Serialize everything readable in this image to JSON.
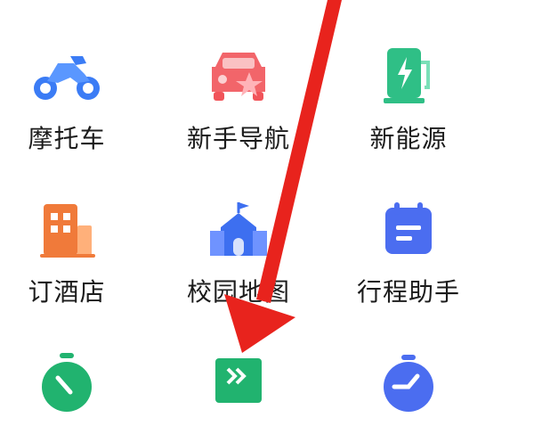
{
  "grid": {
    "items": [
      {
        "label": "摩托车",
        "icon": "motorcycle-icon"
      },
      {
        "label": "新手导航",
        "icon": "novice-car-icon"
      },
      {
        "label": "新能源",
        "icon": "ev-charging-icon"
      },
      {
        "label": "订酒店",
        "icon": "hotel-icon"
      },
      {
        "label": "校园地图",
        "icon": "campus-icon"
      },
      {
        "label": "行程助手",
        "icon": "calendar-icon"
      },
      {
        "label": "",
        "icon": "stopwatch-icon"
      },
      {
        "label": "",
        "icon": "forward-flag-icon"
      },
      {
        "label": "",
        "icon": "speed-timer-icon"
      }
    ]
  },
  "colors": {
    "arrow": "#e8231d",
    "motorcycle": "#3b7cf5",
    "car": "#f1545a",
    "ev": "#2fbf86",
    "hotel": "#f07a3a",
    "campus": "#3d6ff0",
    "calendar": "#4b6df0",
    "timer_green": "#21b36f",
    "flag_green": "#21b36f"
  }
}
